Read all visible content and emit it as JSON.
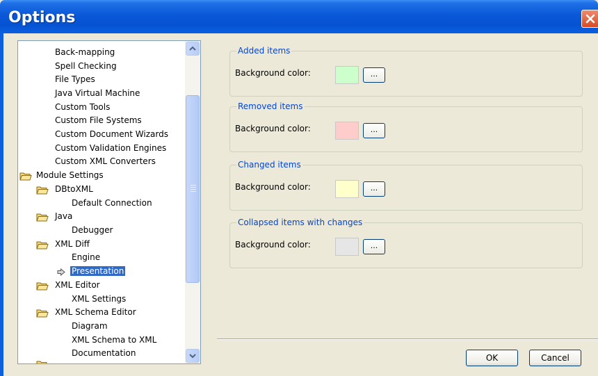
{
  "window": {
    "title": "Options"
  },
  "tree": {
    "items": [
      {
        "label": "Back-mapping"
      },
      {
        "label": "Spell Checking"
      },
      {
        "label": "File Types"
      },
      {
        "label": "Java Virtual Machine"
      },
      {
        "label": "Custom Tools"
      },
      {
        "label": "Custom File Systems"
      },
      {
        "label": "Custom Document Wizards"
      },
      {
        "label": "Custom Validation Engines"
      },
      {
        "label": "Custom XML Converters"
      },
      {
        "label": "Module Settings"
      },
      {
        "label": "DBtoXML"
      },
      {
        "label": "Default Connection"
      },
      {
        "label": "Java"
      },
      {
        "label": "Debugger"
      },
      {
        "label": "XML Diff"
      },
      {
        "label": "Engine"
      },
      {
        "label": "Presentation"
      },
      {
        "label": "XML Editor"
      },
      {
        "label": "XML Settings"
      },
      {
        "label": "XML Schema Editor"
      },
      {
        "label": "Diagram"
      },
      {
        "label": "XML Schema to XML"
      },
      {
        "label": "Documentation"
      }
    ]
  },
  "groups": [
    {
      "title": "Added items",
      "label": "Background color:",
      "color": "#ccffcc",
      "button": "..."
    },
    {
      "title": "Removed items",
      "label": "Background color:",
      "color": "#ffcccc",
      "button": "..."
    },
    {
      "title": "Changed items",
      "label": "Background color:",
      "color": "#ffffcc",
      "button": "..."
    },
    {
      "title": "Collapsed items with changes",
      "label": "Background color:",
      "color": "#e6e6e6",
      "button": "..."
    }
  ],
  "buttons": {
    "ok": "OK",
    "cancel": "Cancel"
  }
}
